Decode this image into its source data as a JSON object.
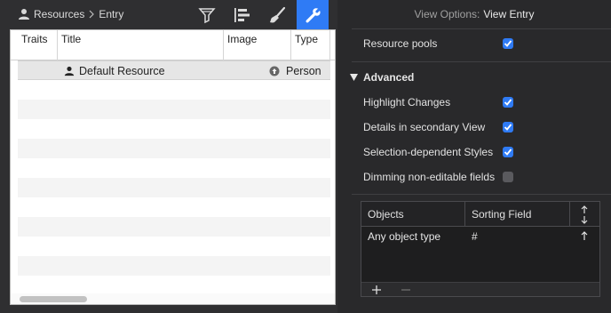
{
  "breadcrumb": {
    "root": "Resources",
    "current": "Entry"
  },
  "toolbar": {
    "filter_icon": "filter-icon",
    "outline_icon": "outline-icon",
    "brush_icon": "brush-icon",
    "wrench_icon": "wrench-icon",
    "active_tab": "wrench"
  },
  "table": {
    "columns": [
      "Traits",
      "Title",
      "Image",
      "Type"
    ],
    "rows": [
      {
        "title": "Default Resource",
        "image_icon": "circle-arrow-icon",
        "type": "Person"
      }
    ]
  },
  "view_options": {
    "label": "View Options:",
    "value": "View Entry"
  },
  "options": {
    "resource_pools": {
      "label": "Resource pools",
      "checked": true
    },
    "advanced": {
      "label": "Advanced",
      "expanded": true
    },
    "highlight_changes": {
      "label": "Highlight Changes",
      "checked": true
    },
    "details_secondary": {
      "label": "Details in secondary View",
      "checked": true
    },
    "selection_styles": {
      "label": "Selection-dependent Styles",
      "checked": true
    },
    "dimming": {
      "label": "Dimming non-editable fields",
      "checked": false
    }
  },
  "sort_table": {
    "columns": [
      "Objects",
      "Sorting Field"
    ],
    "sort_toggle_icon": "up-down-arrows-icon",
    "rows": [
      {
        "object": "Any object type",
        "field": "#",
        "direction_icon": "up-arrow-icon"
      }
    ],
    "add_label": "+",
    "remove_label": "−"
  },
  "colors": {
    "accent": "#2f7bf5",
    "pane_bg": "#29292b",
    "toolbar_bg": "#2f2f31"
  }
}
